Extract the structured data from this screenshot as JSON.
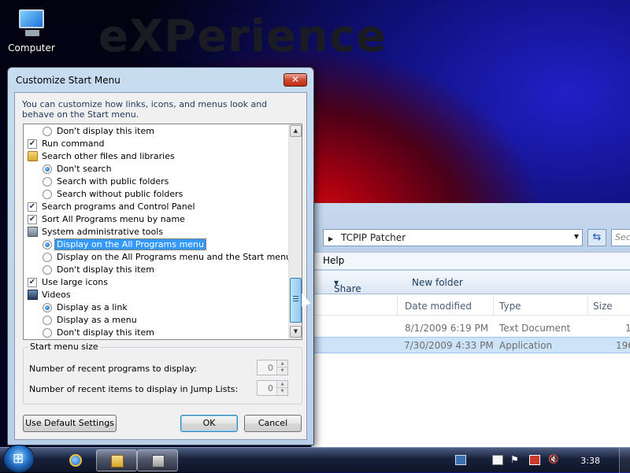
{
  "desktop": {
    "wallpaper_text": "eXPerience",
    "icons": [
      {
        "label": "Computer",
        "icon": "computer-icon"
      }
    ]
  },
  "explorer": {
    "address": "TCPIP Patcher",
    "search_placeholder": "Sec",
    "menu": [
      "Help"
    ],
    "toolbar": {
      "share_with": "Share with",
      "new_folder": "New folder"
    },
    "columns": [
      "Date modified",
      "Type",
      "Size"
    ],
    "files": [
      {
        "date": "8/1/2009 6:19 PM",
        "type": "Text Document",
        "size": "1",
        "selected": false
      },
      {
        "date": "7/30/2009 4:33 PM",
        "type": "Application",
        "size": "196",
        "selected": true
      }
    ]
  },
  "dialog": {
    "title": "Customize Start Menu",
    "close_label": "✕",
    "intro": "You can customize how links, icons, and menus look and behave on the Start menu.",
    "items": [
      {
        "kind": "radio",
        "indent": true,
        "checked": false,
        "label": "Don't display this item"
      },
      {
        "kind": "checkbox",
        "indent": false,
        "checked": true,
        "label": "Run command"
      },
      {
        "kind": "header",
        "icon": "folder",
        "label": "Search other files and libraries"
      },
      {
        "kind": "radio",
        "indent": true,
        "checked": true,
        "label": "Don't search"
      },
      {
        "kind": "radio",
        "indent": true,
        "checked": false,
        "label": "Search with public folders"
      },
      {
        "kind": "radio",
        "indent": true,
        "checked": false,
        "label": "Search without public folders"
      },
      {
        "kind": "checkbox",
        "indent": false,
        "checked": true,
        "label": "Search programs and Control Panel"
      },
      {
        "kind": "checkbox",
        "indent": false,
        "checked": true,
        "label": "Sort All Programs menu by name"
      },
      {
        "kind": "header",
        "icon": "admin",
        "label": "System administrative tools"
      },
      {
        "kind": "radio",
        "indent": true,
        "checked": true,
        "selected": true,
        "label": "Display on the All Programs menu"
      },
      {
        "kind": "radio",
        "indent": true,
        "checked": false,
        "label": "Display on the All Programs menu and the Start menu"
      },
      {
        "kind": "radio",
        "indent": true,
        "checked": false,
        "label": "Don't display this item"
      },
      {
        "kind": "checkbox",
        "indent": false,
        "checked": true,
        "label": "Use large icons"
      },
      {
        "kind": "header",
        "icon": "video",
        "label": "Videos"
      },
      {
        "kind": "radio",
        "indent": true,
        "checked": true,
        "label": "Display as a link"
      },
      {
        "kind": "radio",
        "indent": true,
        "checked": false,
        "label": "Display as a menu"
      },
      {
        "kind": "radio",
        "indent": true,
        "checked": false,
        "label": "Don't display this item"
      }
    ],
    "start_menu_size": {
      "title": "Start menu size",
      "recent_programs_label": "Number of recent programs to display:",
      "recent_programs_value": "0",
      "recent_items_label": "Number of recent items to display in Jump Lists:",
      "recent_items_value": "0"
    },
    "buttons": {
      "default_settings": "Use Default Settings",
      "ok": "OK",
      "cancel": "Cancel"
    }
  },
  "taskbar": {
    "pinned": [
      "internet-explorer-icon",
      "windows-explorer-icon",
      "patcher-app-icon"
    ],
    "tray": [
      "network-icon",
      "document-icon",
      "flag-icon",
      "battery-icon",
      "volume-muted-icon"
    ],
    "clock": "3:38"
  },
  "colors": {
    "selection": "#3399ff",
    "title_bar": "#c8dcf0",
    "close_button": "#cf4b33"
  }
}
